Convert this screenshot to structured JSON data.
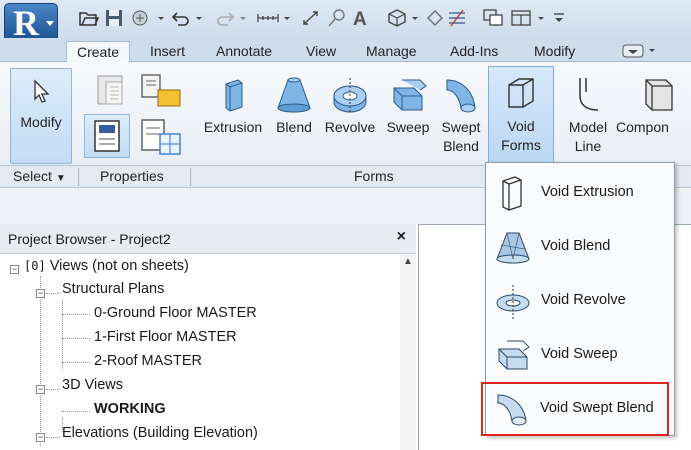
{
  "app": {
    "logo_letter": "R"
  },
  "tabs": [
    "Create",
    "Insert",
    "Annotate",
    "View",
    "Manage",
    "Add-Ins",
    "Modify"
  ],
  "ribbon": {
    "modify_label": "Modify",
    "buttons": {
      "extrusion": "Extrusion",
      "blend": "Blend",
      "revolve": "Revolve",
      "sweep": "Sweep",
      "swept_blend_1": "Swept",
      "swept_blend_2": "Blend",
      "void_1": "Void",
      "void_2": "Forms",
      "model_line_1": "Model",
      "model_line_2": "Line",
      "component": "Compon"
    },
    "panels": {
      "select": "Select",
      "properties": "Properties",
      "forms": "Forms"
    }
  },
  "project_browser": {
    "title": "Project Browser - Project2",
    "close": "×",
    "tree": {
      "views_root": "Views (not on sheets)",
      "structural_plans": "Structural Plans",
      "plan_0": "0-Ground Floor MASTER",
      "plan_1": "1-First Floor MASTER",
      "plan_2": "2-Roof MASTER",
      "views_3d": "3D Views",
      "working": "WORKING",
      "elevations": "Elevations (Building Elevation)"
    }
  },
  "void_menu": {
    "items": [
      "Void Extrusion",
      "Void Blend",
      "Void Revolve",
      "Void Sweep",
      "Void Swept Blend"
    ],
    "highlight_color": "#e0231e"
  }
}
